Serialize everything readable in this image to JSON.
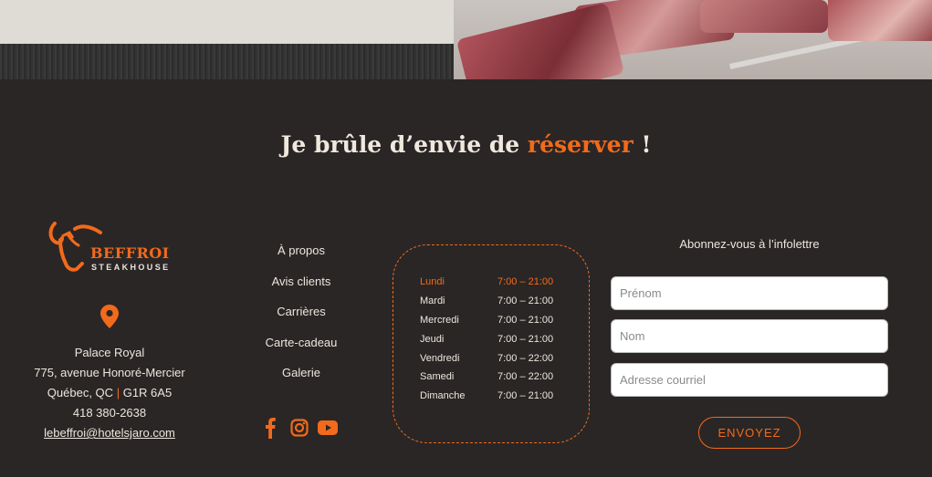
{
  "headline": {
    "prefix": "Je brûle d’envie de ",
    "accent": "réserver",
    "suffix": " !"
  },
  "brand": {
    "name": "BEFFROI",
    "tagline": "STEAKHOUSE",
    "accent_color": "#f26a1b"
  },
  "address": {
    "name": "Palace Royal",
    "street": "775, avenue Honoré-Mercier",
    "city": "Québec, QC",
    "separator": "|",
    "postal": "G1R 6A5",
    "phone": "418 380-2638",
    "email": "lebeffroi@hotelsjaro.com"
  },
  "nav": {
    "items": [
      {
        "label": "À propos"
      },
      {
        "label": "Avis clients"
      },
      {
        "label": "Carrières"
      },
      {
        "label": "Carte-cadeau"
      },
      {
        "label": "Galerie"
      }
    ]
  },
  "social": {
    "icons": [
      "facebook-icon",
      "instagram-icon",
      "youtube-icon"
    ]
  },
  "hours": {
    "rows": [
      {
        "day": "Lundi",
        "time": "7:00 – 21:00",
        "active": true
      },
      {
        "day": "Mardi",
        "time": "7:00 – 21:00"
      },
      {
        "day": "Mercredi",
        "time": "7:00 – 21:00"
      },
      {
        "day": "Jeudi",
        "time": "7:00 – 21:00"
      },
      {
        "day": "Vendredi",
        "time": "7:00 – 22:00"
      },
      {
        "day": "Samedi",
        "time": "7:00 – 22:00"
      },
      {
        "day": "Dimanche",
        "time": "7:00 – 21:00"
      }
    ]
  },
  "newsletter": {
    "title": "Abonnez-vous à l’infolettre",
    "firstname_placeholder": "Prénom",
    "lastname_placeholder": "Nom",
    "email_placeholder": "Adresse courriel",
    "submit_label": "ENVOYEZ"
  }
}
